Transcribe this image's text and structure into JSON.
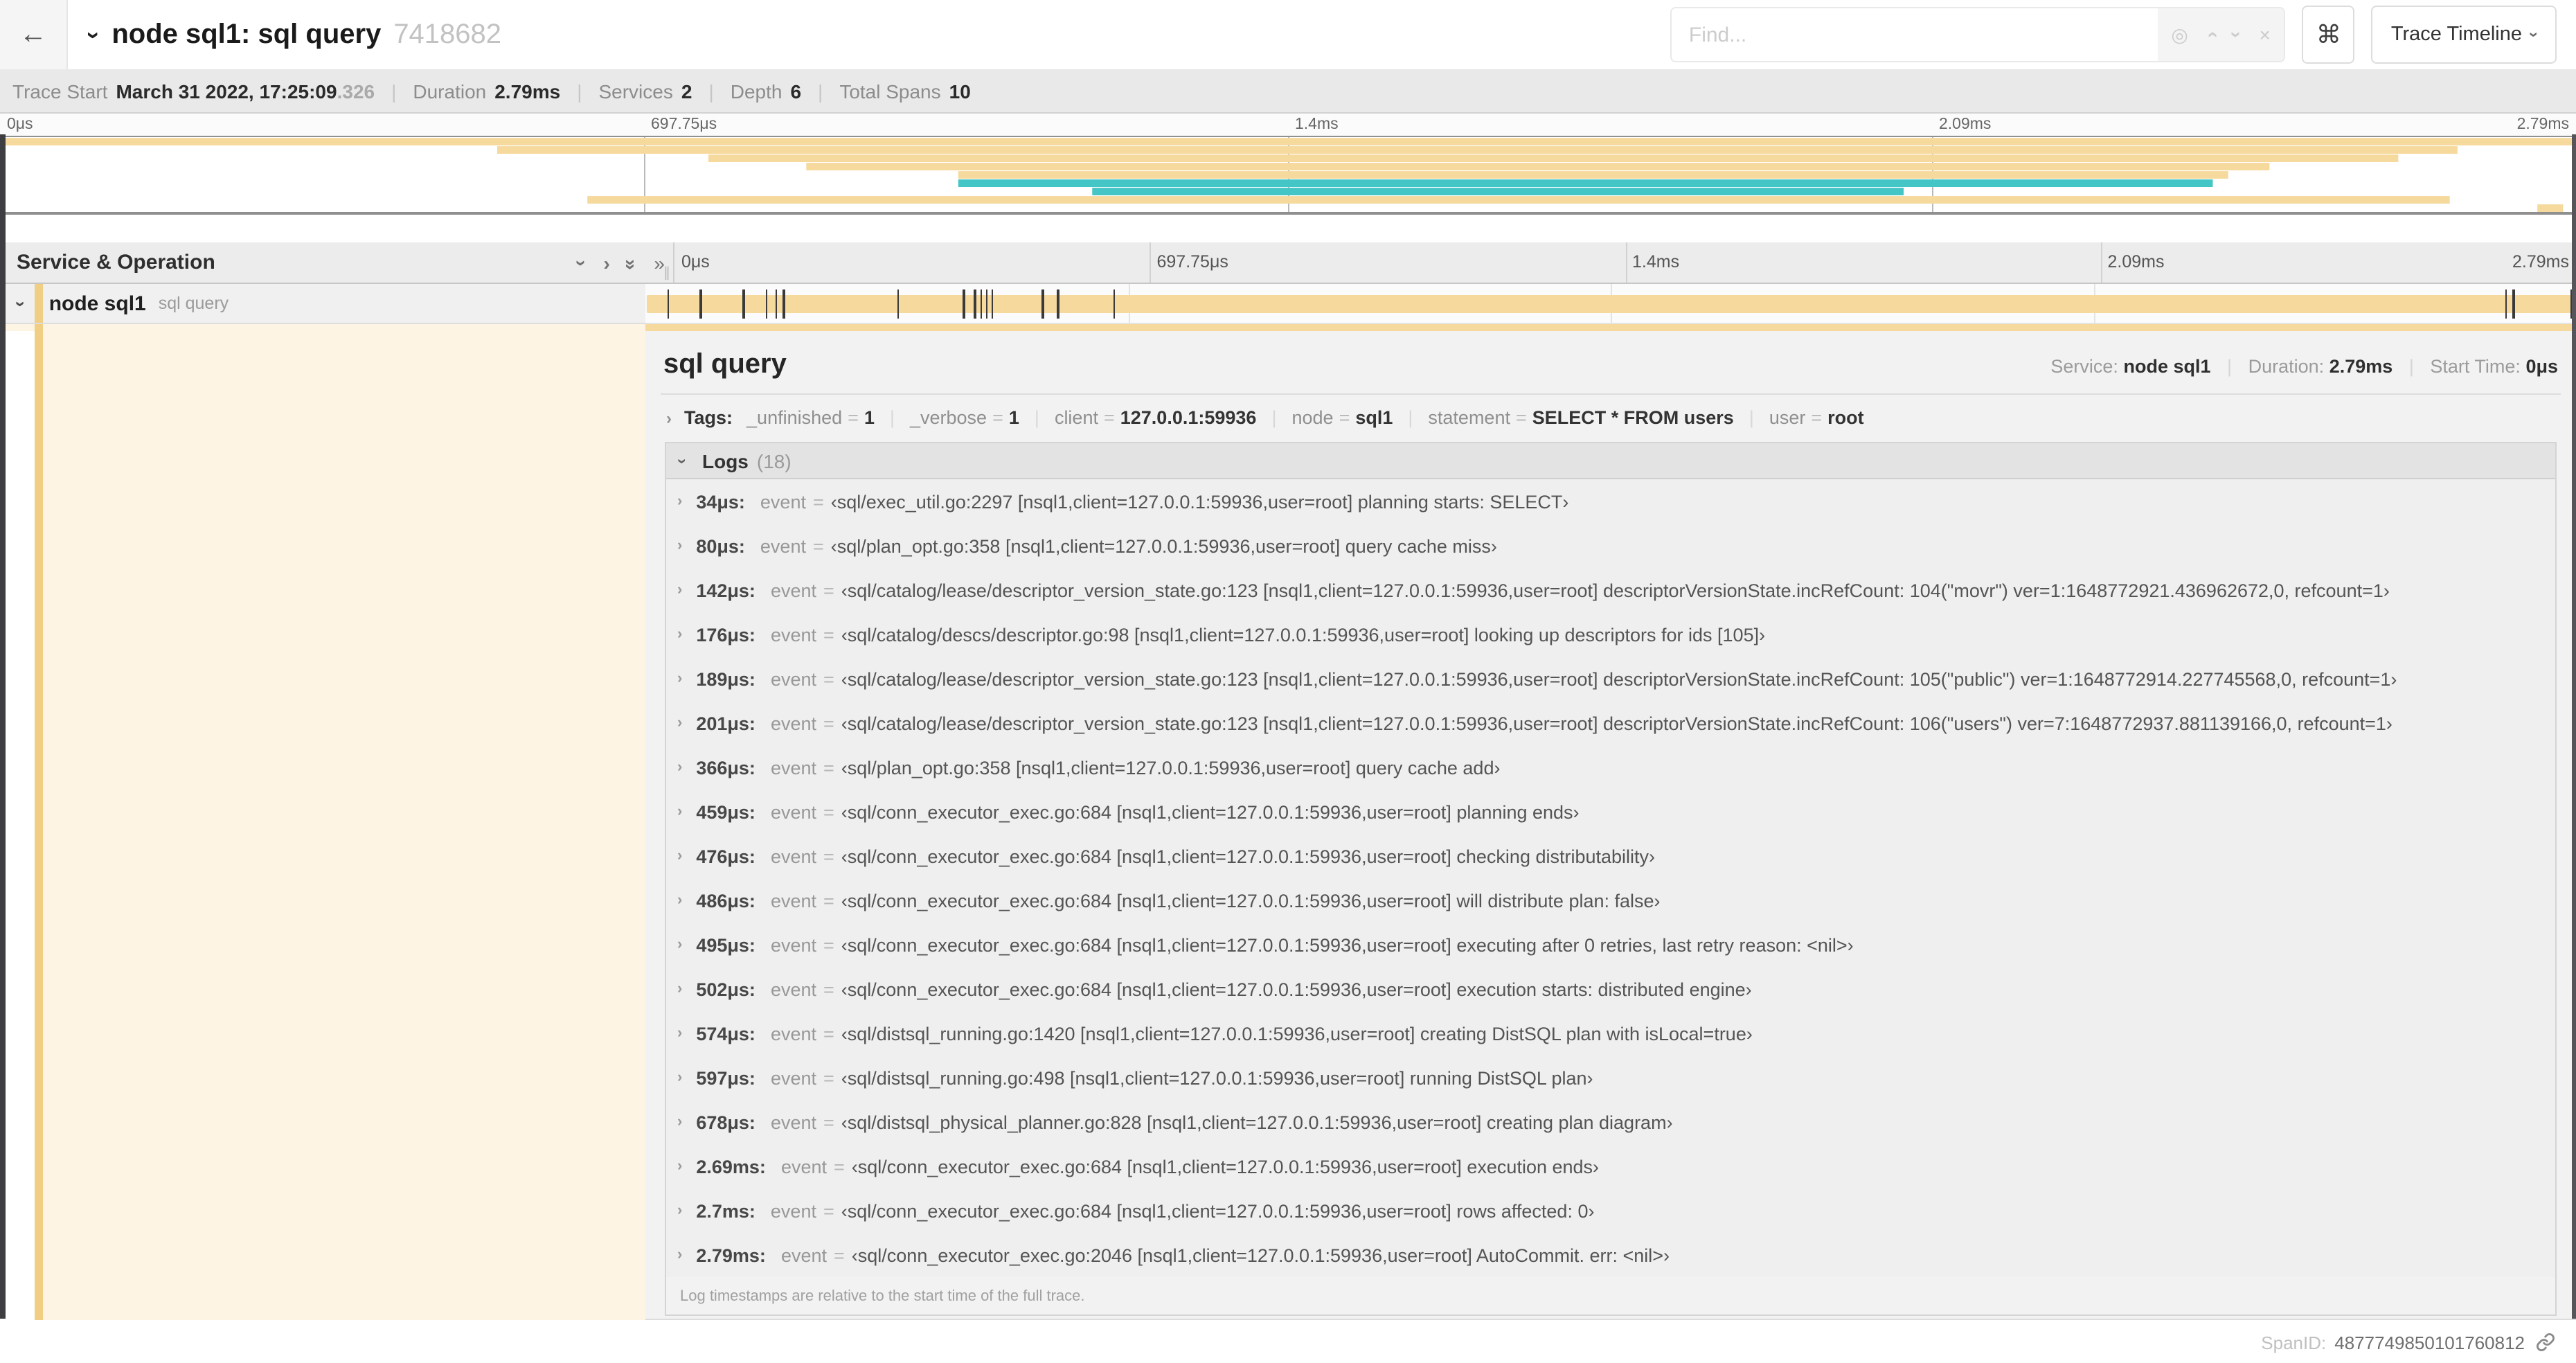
{
  "header": {
    "back": "←",
    "title": "node sql1: sql query",
    "trace_id": "7418682",
    "find_placeholder": "Find...",
    "shortcut_button": "⌘",
    "view_button": "Trace Timeline"
  },
  "summary": {
    "items": [
      {
        "label": "Trace Start",
        "value": "March 31 2022, 17:25:09",
        "suffix": ".326"
      },
      {
        "label": "Duration",
        "value": "2.79ms"
      },
      {
        "label": "Services",
        "value": "2"
      },
      {
        "label": "Depth",
        "value": "6"
      },
      {
        "label": "Total Spans",
        "value": "10"
      }
    ]
  },
  "colors": {
    "tan": "#f6d99d",
    "tan_dark": "#f0cf85",
    "cream": "#fdf4e3",
    "teal": "#44c5c6"
  },
  "minimap": {
    "ticks": [
      {
        "label": "0μs",
        "pos": 0
      },
      {
        "label": "697.75μs",
        "pos": 0.25
      },
      {
        "label": "1.4ms",
        "pos": 0.5
      },
      {
        "label": "2.09ms",
        "pos": 0.75
      },
      {
        "label": "2.79ms",
        "pos": 1
      }
    ],
    "bars": [
      {
        "s": 0.0,
        "e": 1.0,
        "c": "tan"
      },
      {
        "s": 0.193,
        "e": 0.954,
        "c": "tan"
      },
      {
        "s": 0.275,
        "e": 0.931,
        "c": "tan"
      },
      {
        "s": 0.313,
        "e": 0.881,
        "c": "tan"
      },
      {
        "s": 0.372,
        "e": 0.865,
        "c": "tan"
      },
      {
        "s": 0.372,
        "e": 0.859,
        "c": "teal"
      },
      {
        "s": 0.424,
        "e": 0.739,
        "c": "teal"
      },
      {
        "s": 0.228,
        "e": 0.951,
        "c": "tan"
      },
      {
        "s": 0.985,
        "e": 0.995,
        "c": "tan"
      }
    ]
  },
  "timeline": {
    "left_header": "Service & Operation",
    "row": {
      "service": "node sql1",
      "operation": "sql query"
    },
    "log_marker_positions": [
      0.012,
      0.029,
      0.051,
      0.063,
      0.068,
      0.072,
      0.131,
      0.165,
      0.171,
      0.174,
      0.177,
      0.18,
      0.206,
      0.214,
      0.243,
      0.964,
      0.968,
      0.998
    ]
  },
  "detail": {
    "title": "sql query",
    "service_label": "Service:",
    "service": "node sql1",
    "duration_label": "Duration:",
    "duration": "2.79ms",
    "start_label": "Start Time:",
    "start": "0μs",
    "tags_label": "Tags:",
    "eq": "=",
    "tags": [
      {
        "k": "_unfinished",
        "v": "1"
      },
      {
        "k": "_verbose",
        "v": "1"
      },
      {
        "k": "client",
        "v": "127.0.0.1:59936"
      },
      {
        "k": "node",
        "v": "sql1"
      },
      {
        "k": "statement",
        "v": "SELECT * FROM users"
      },
      {
        "k": "user",
        "v": "root"
      }
    ],
    "logs_label": "Logs",
    "logs_count": "(18)",
    "log_field": "event",
    "logs": [
      {
        "t": "34μs:",
        "v": "‹sql/exec_util.go:2297 [nsql1,client=127.0.0.1:59936,user=root] planning starts: SELECT›"
      },
      {
        "t": "80μs:",
        "v": "‹sql/plan_opt.go:358 [nsql1,client=127.0.0.1:59936,user=root] query cache miss›"
      },
      {
        "t": "142μs:",
        "v": "‹sql/catalog/lease/descriptor_version_state.go:123 [nsql1,client=127.0.0.1:59936,user=root] descriptorVersionState.incRefCount: 104(\"movr\") ver=1:1648772921.436962672,0, refcount=1›"
      },
      {
        "t": "176μs:",
        "v": "‹sql/catalog/descs/descriptor.go:98 [nsql1,client=127.0.0.1:59936,user=root] looking up descriptors for ids [105]›"
      },
      {
        "t": "189μs:",
        "v": "‹sql/catalog/lease/descriptor_version_state.go:123 [nsql1,client=127.0.0.1:59936,user=root] descriptorVersionState.incRefCount: 105(\"public\") ver=1:1648772914.227745568,0, refcount=1›"
      },
      {
        "t": "201μs:",
        "v": "‹sql/catalog/lease/descriptor_version_state.go:123 [nsql1,client=127.0.0.1:59936,user=root] descriptorVersionState.incRefCount: 106(\"users\") ver=7:1648772937.881139166,0, refcount=1›"
      },
      {
        "t": "366μs:",
        "v": "‹sql/plan_opt.go:358 [nsql1,client=127.0.0.1:59936,user=root] query cache add›"
      },
      {
        "t": "459μs:",
        "v": "‹sql/conn_executor_exec.go:684 [nsql1,client=127.0.0.1:59936,user=root] planning ends›"
      },
      {
        "t": "476μs:",
        "v": "‹sql/conn_executor_exec.go:684 [nsql1,client=127.0.0.1:59936,user=root] checking distributability›"
      },
      {
        "t": "486μs:",
        "v": "‹sql/conn_executor_exec.go:684 [nsql1,client=127.0.0.1:59936,user=root] will distribute plan: false›"
      },
      {
        "t": "495μs:",
        "v": "‹sql/conn_executor_exec.go:684 [nsql1,client=127.0.0.1:59936,user=root] executing after 0 retries, last retry reason: <nil>›"
      },
      {
        "t": "502μs:",
        "v": "‹sql/conn_executor_exec.go:684 [nsql1,client=127.0.0.1:59936,user=root] execution starts: distributed engine›"
      },
      {
        "t": "574μs:",
        "v": "‹sql/distsql_running.go:1420 [nsql1,client=127.0.0.1:59936,user=root] creating DistSQL plan with isLocal=true›"
      },
      {
        "t": "597μs:",
        "v": "‹sql/distsql_running.go:498 [nsql1,client=127.0.0.1:59936,user=root] running DistSQL plan›"
      },
      {
        "t": "678μs:",
        "v": "‹sql/distsql_physical_planner.go:828 [nsql1,client=127.0.0.1:59936,user=root] creating plan diagram›"
      },
      {
        "t": "2.69ms:",
        "v": "‹sql/conn_executor_exec.go:684 [nsql1,client=127.0.0.1:59936,user=root] execution ends›"
      },
      {
        "t": "2.7ms:",
        "v": "‹sql/conn_executor_exec.go:684 [nsql1,client=127.0.0.1:59936,user=root] rows affected: 0›"
      },
      {
        "t": "2.79ms:",
        "v": "‹sql/conn_executor_exec.go:2046 [nsql1,client=127.0.0.1:59936,user=root] AutoCommit. err: <nil>›"
      }
    ],
    "footnote": "Log timestamps are relative to the start time of the full trace.",
    "span_id_label": "SpanID:",
    "span_id": "4877749850101760812"
  }
}
